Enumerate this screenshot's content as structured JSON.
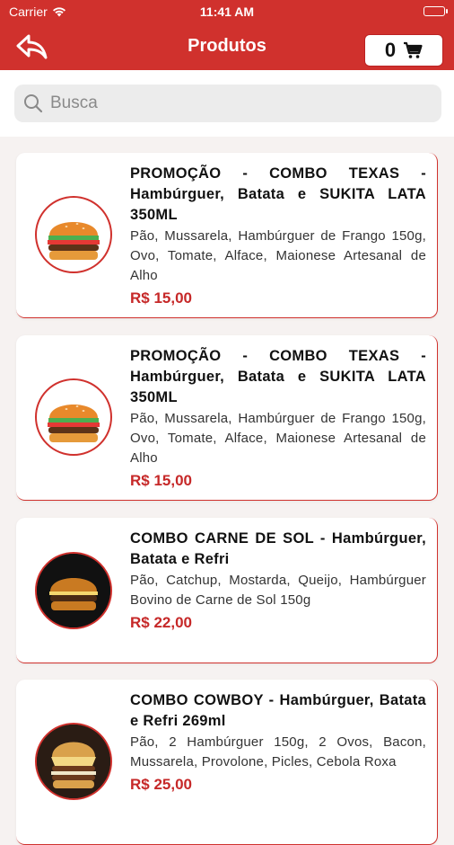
{
  "status_bar": {
    "carrier": "Carrier",
    "time": "11:41 AM"
  },
  "header": {
    "title": "Produtos",
    "cart_count": "0"
  },
  "search": {
    "placeholder": "Busca",
    "value": ""
  },
  "colors": {
    "primary": "#d0312d",
    "price": "#c62828"
  },
  "products": [
    {
      "name": "PROMOÇÃO - COMBO TEXAS - Hambúrguer, Batata e SUKITA LATA 350ML",
      "description": "Pão, Mussarela, Hambúrguer de Frango 150g, Ovo, Tomate, Alface, Maionese Artesanal de Alho",
      "price": "R$ 15,00",
      "image_icon": "burger-image"
    },
    {
      "name": "PROMOÇÃO - COMBO TEXAS - Hambúrguer, Batata e SUKITA LATA 350ML",
      "description": "Pão, Mussarela, Hambúrguer de Frango 150g, Ovo, Tomate, Alface, Maionese Artesanal de Alho",
      "price": "R$ 15,00",
      "image_icon": "burger-image"
    },
    {
      "name": "COMBO CARNE DE SOL - Hambúrguer, Batata e Refri",
      "description": "Pão, Catchup, Mostarda, Queijo, Hambúrguer Bovino de Carne de Sol 150g",
      "price": "R$ 22,00",
      "image_icon": "burger-image"
    },
    {
      "name": "COMBO COWBOY - Hambúrguer, Batata e Refri 269ml",
      "description": "Pão, 2 Hambúrguer 150g, 2 Ovos, Bacon, Mussarela, Provolone, Picles, Cebola Roxa",
      "price": "R$ 25,00",
      "image_icon": "burger-image"
    }
  ]
}
